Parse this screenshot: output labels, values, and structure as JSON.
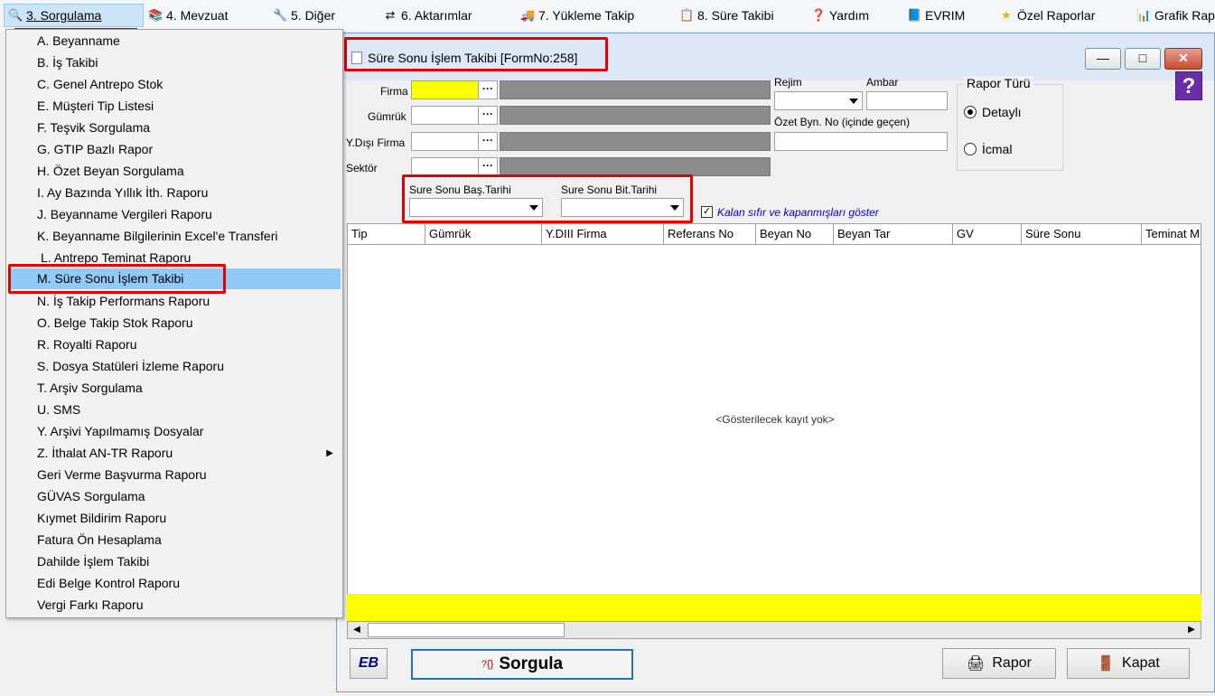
{
  "menubar": {
    "items": [
      {
        "icon": "search-icon",
        "label": "3.  Sorgulama"
      },
      {
        "icon": "books-icon",
        "label": "4.  Mevzuat"
      },
      {
        "icon": "tools-icon",
        "label": "5.  Diğer"
      },
      {
        "icon": "transfer-icon",
        "label": "6.  Aktarımlar"
      },
      {
        "icon": "truck-icon",
        "label": "7.  Yükleme Takip"
      },
      {
        "icon": "clipboard-icon",
        "label": "8. Süre Takibi"
      },
      {
        "icon": "help-icon",
        "label": "Yardım"
      },
      {
        "icon": "book-icon",
        "label": "EVRIM"
      },
      {
        "icon": "star-icon",
        "label": "Özel Raporlar"
      },
      {
        "icon": "chart-icon",
        "label": "Grafik Rap"
      }
    ]
  },
  "dropdown": {
    "items": [
      "A.  Beyanname",
      "B.  İş Takibi",
      "C.  Genel Antrepo Stok",
      "E.  Müşteri Tip Listesi",
      "F.  Teşvik Sorgulama",
      "G.  GTIP Bazlı Rapor",
      "H.  Özet Beyan Sorgulama",
      "I.   Ay Bazında Yıllık İth. Raporu",
      "J.   Beyanname Vergileri Raporu",
      "K.  Beyanname Bilgilerinin Excel'e Transferi",
      "L.  Antrepo Teminat Raporu",
      "M.  Süre Sonu İşlem Takibi",
      "N.  İş Takip Performans Raporu",
      "O.  Belge Takip Stok Raporu",
      "R.  Royalti Raporu",
      "S.   Dosya Statüleri İzleme Raporu",
      "T.   Arşiv Sorgulama",
      "U.  SMS",
      "Y.  Arşivi Yapılmamış Dosyalar",
      "Z.  İthalat AN-TR Raporu",
      "Geri Verme Başvurma Raporu",
      "GÜVAS Sorgulama",
      "Kıymet Bildirim Raporu",
      "Fatura Ön Hesaplama",
      "Dahilde İşlem Takibi",
      "Edi Belge Kontrol Raporu",
      "Vergi Farkı Raporu"
    ]
  },
  "form": {
    "title": "Süre Sonu İşlem Takibi [FormNo:258]",
    "labels": {
      "firma": "Firma",
      "gumruk": "Gümrük",
      "ydisi_firma": "Y.Dışı Firma",
      "sektor": "Sektör",
      "rejim": "Rejim",
      "ambar": "Ambar",
      "ozet_byn": "Özet Byn. No (içinde geçen)",
      "rapor_turu": "Rapor Türü",
      "detayli": "Detaylı",
      "icmal": "İcmal",
      "bas_tarihi": "Sure Sonu Baş.Tarihi",
      "bit_tarihi": "Sure Sonu Bit.Tarihi",
      "kalan": "Kalan sıfır ve kapanmışları göster"
    },
    "ellipsis": "···",
    "checkmark": "✓",
    "help_glyph": "?",
    "win_buttons": {
      "minimize": "—",
      "maximize": "□",
      "close": "✕"
    },
    "grid": {
      "columns": [
        "Tip",
        "Gümrük",
        "Y.DIII Firma",
        "Referans No",
        "Beyan No",
        "Beyan Tar",
        "GV",
        "Süre Sonu",
        "Teminat M"
      ],
      "empty_text": "<Gösterilecek kayıt yok>"
    },
    "scroll": {
      "left": "◀",
      "right": "▶"
    },
    "buttons": {
      "eb": "EB",
      "sorgula_icon": "?{}",
      "sorgula": "Sorgula",
      "rapor": "Rapor",
      "kapat": "Kapat"
    },
    "colors": {
      "highlight": "#ffff00",
      "selection": "#91c9f7",
      "annotation": "#e00000"
    }
  }
}
